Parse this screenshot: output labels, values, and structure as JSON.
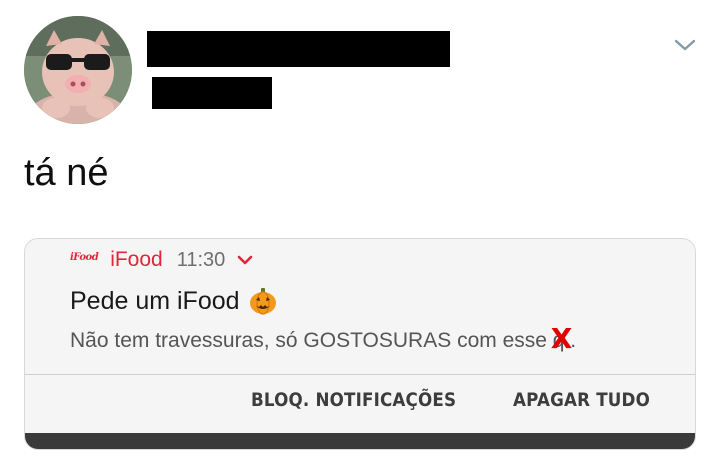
{
  "tweet": {
    "text": "tá né",
    "avatar_icon": "pig-with-sunglasses-avatar",
    "menu_icon": "chevron-down-icon"
  },
  "notification": {
    "app_logo": "iFood",
    "app_name": "iFood",
    "time": "11:30",
    "title": "Pede um iFood",
    "title_emoji": "pumpkin-icon",
    "body_before": "Não tem travessuras, só GOSTOSURAS com esse ",
    "body_cut": "q",
    "body_after": "..",
    "x_mark": "X",
    "accent_color": "#e3253a",
    "actions": {
      "block": "BLOQ. NOTIFICAÇÕES",
      "clear": "APAGAR TUDO"
    }
  }
}
